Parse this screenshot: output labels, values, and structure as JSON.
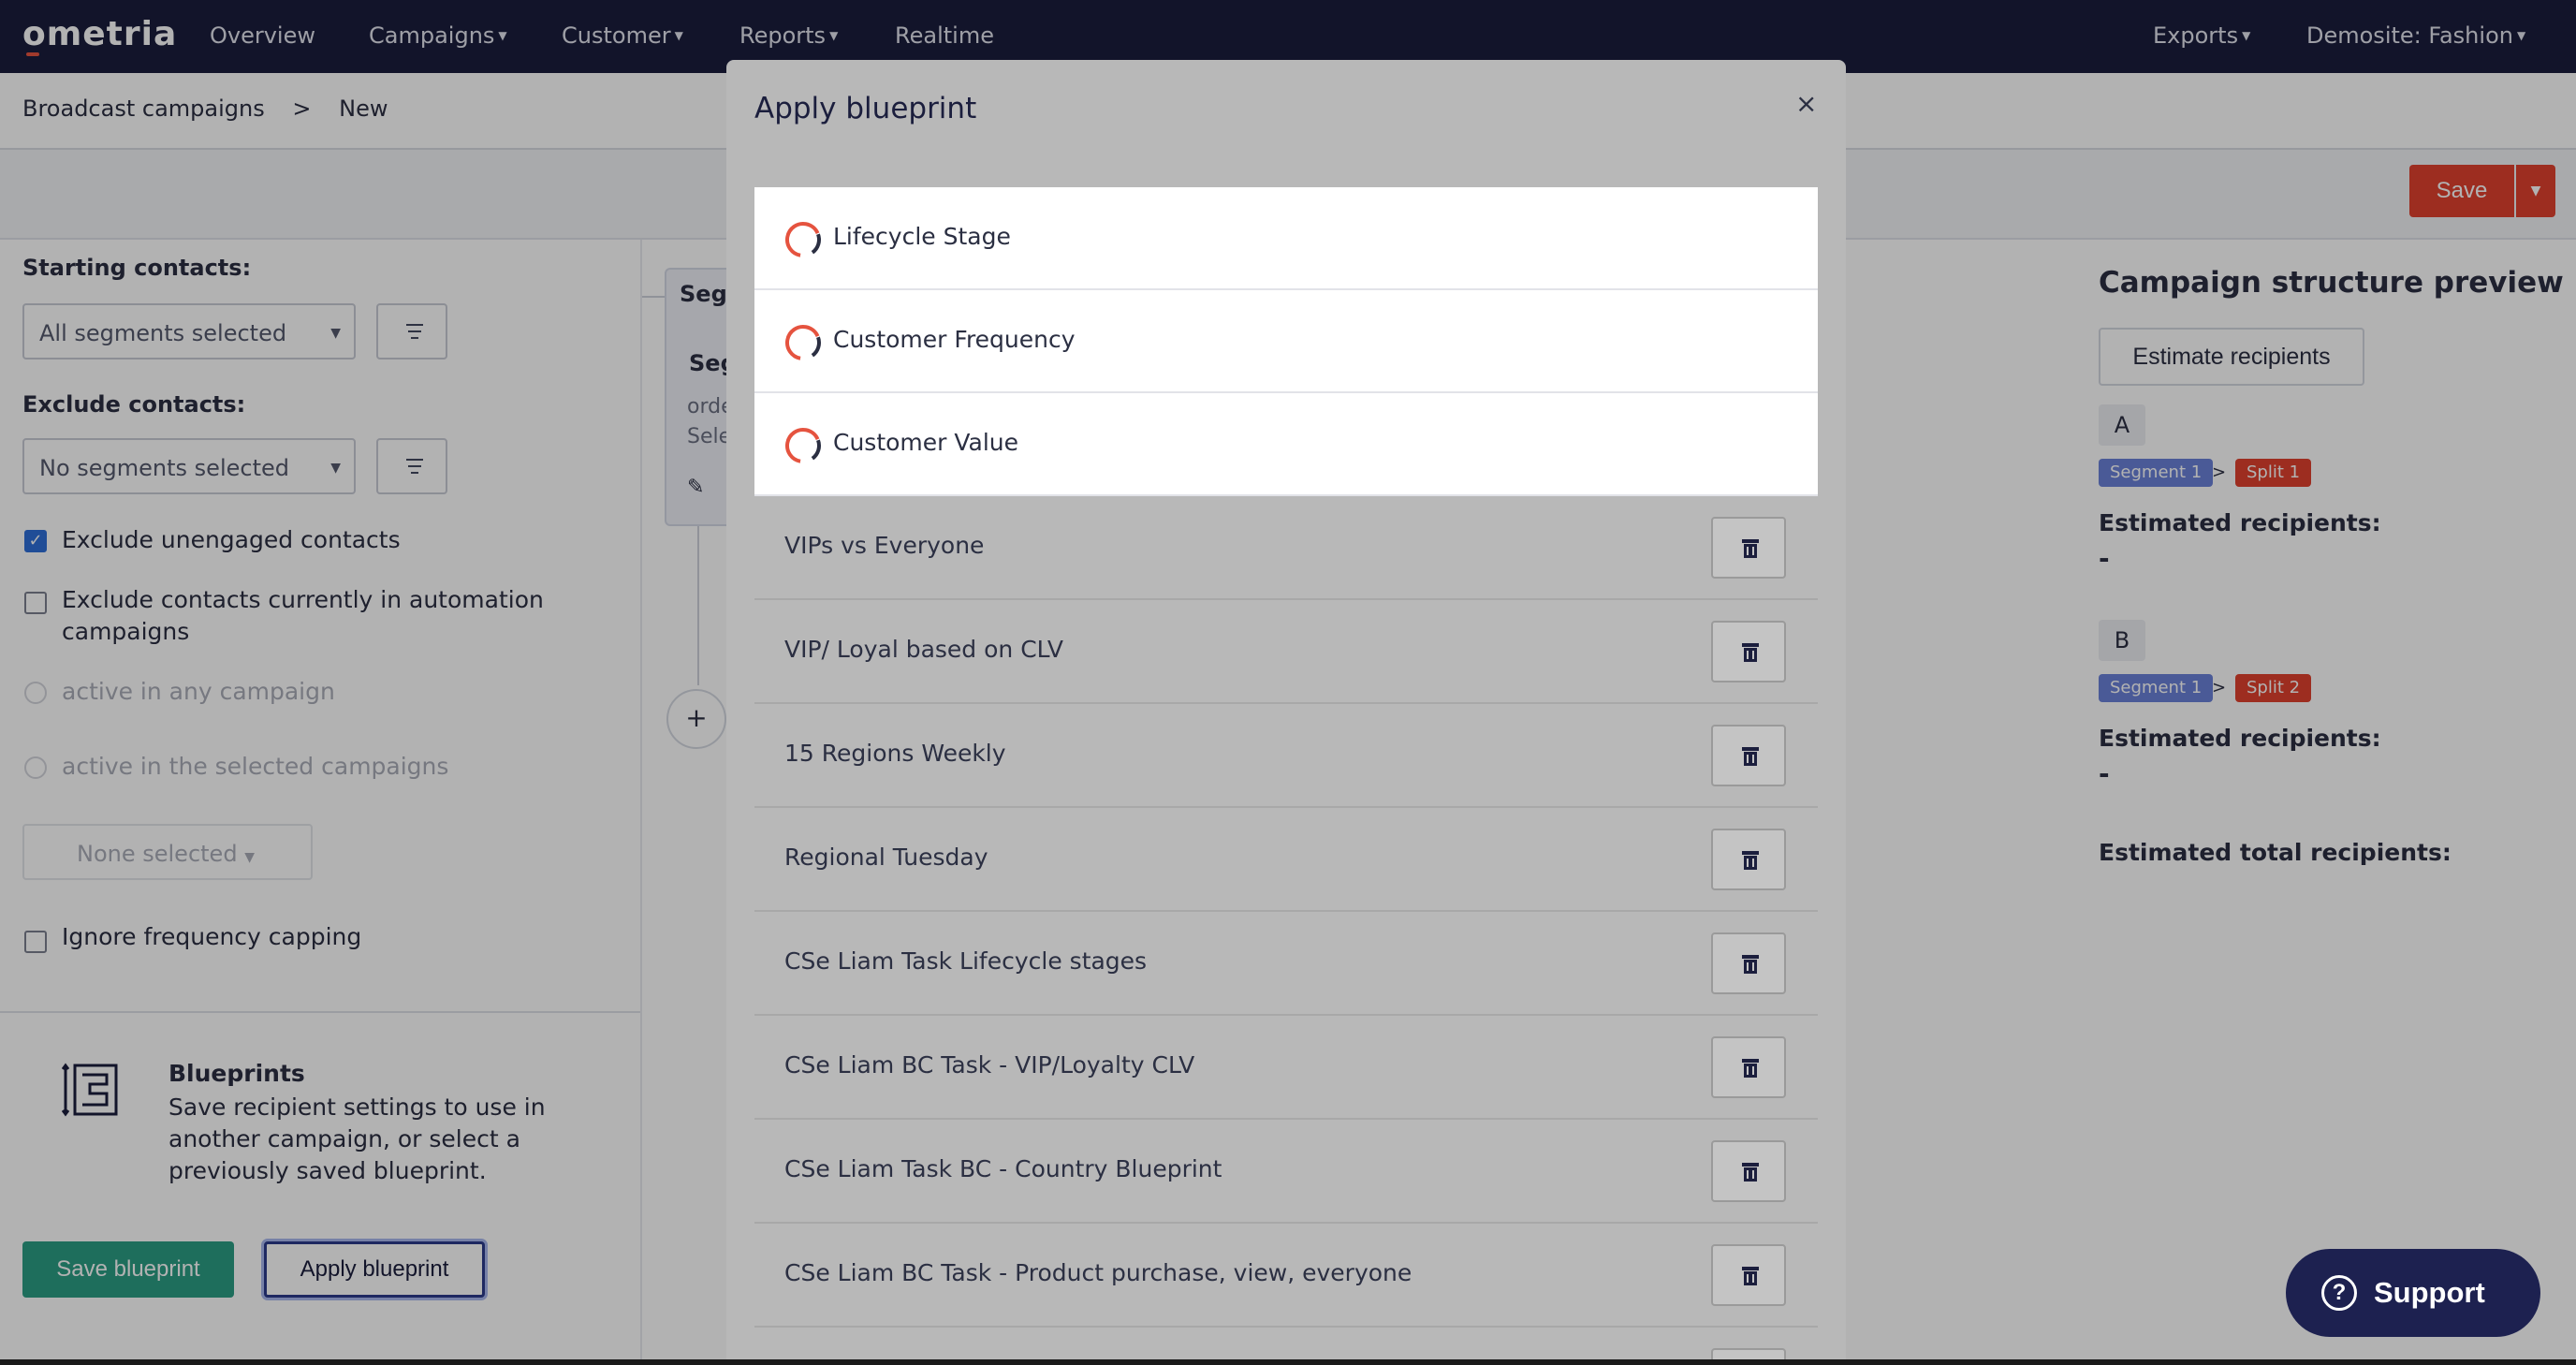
{
  "brand": {
    "logo": "ometria",
    "accent": "#e1412e",
    "nav_bg": "#1b1e3d"
  },
  "topnav": {
    "items": [
      "Overview",
      "Campaigns",
      "Customer",
      "Reports",
      "Realtime"
    ],
    "right": [
      "Exports",
      "Demosite: Fashion"
    ]
  },
  "breadcrumb": {
    "parent": "Broadcast campaigns",
    "separator": ">",
    "current": "New"
  },
  "toolbar": {
    "save_label": "Save"
  },
  "left_panel": {
    "starting_label": "Starting contacts:",
    "starting_value": "All segments selected",
    "exclude_label": "Exclude contacts:",
    "exclude_value": "No segments selected",
    "exclude_unengaged": "Exclude unengaged contacts",
    "exclude_automation": "Exclude contacts currently in automation campaigns",
    "radio_any": "active in any campaign",
    "radio_selected": "active in the selected campaigns",
    "none_selected": "None selected",
    "ignore_capping": "Ignore frequency capping",
    "blueprints_title": "Blueprints",
    "blueprints_desc": "Save recipient settings to use in another campaign, or select a previously saved blueprint.",
    "save_blueprint": "Save blueprint",
    "apply_blueprint": "Apply blueprint"
  },
  "canvas": {
    "card_header": "Segm",
    "card_sub": "Seg",
    "line1": "orde",
    "line2": "Sele",
    "add": "+"
  },
  "right_panel": {
    "title": "Campaign structure preview",
    "estimate_button": "Estimate recipients",
    "splits": [
      {
        "badge": "A",
        "segment": "Segment 1",
        "arrow": ">",
        "split": "Split 1",
        "est_label": "Estimated recipients:",
        "est_value": "-"
      },
      {
        "badge": "B",
        "segment": "Segment 1",
        "arrow": ">",
        "split": "Split 2",
        "est_label": "Estimated recipients:",
        "est_value": "-"
      }
    ],
    "total_label": "Estimated total recipients:"
  },
  "modal": {
    "title": "Apply blueprint",
    "close": "×",
    "default_blueprints": [
      "Lifecycle Stage",
      "Customer Frequency",
      "Customer Value"
    ],
    "saved_blueprints": [
      "VIPs vs Everyone",
      "VIP/ Loyal based on CLV",
      "15 Regions Weekly",
      "Regional Tuesday",
      "CSe Liam Task Lifecycle stages",
      "CSe Liam BC Task - VIP/Loyalty CLV",
      "CSe Liam Task BC - Country Blueprint",
      "CSe Liam BC Task - Product purchase, view, everyone"
    ]
  },
  "support": {
    "label": "Support",
    "icon": "question-icon"
  }
}
